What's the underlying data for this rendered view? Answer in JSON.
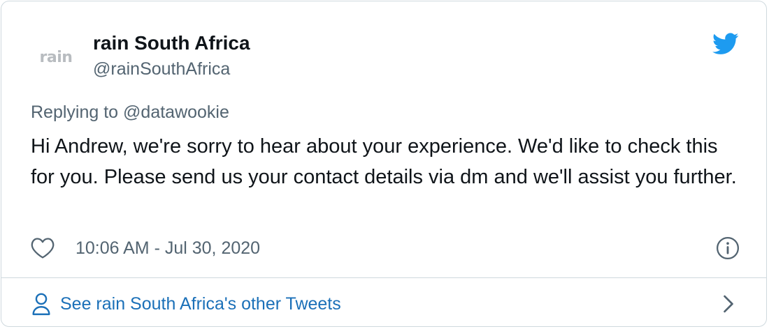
{
  "author": {
    "display_name": "rain South Africa",
    "handle": "@rainSouthAfrica",
    "avatar_text": "rain"
  },
  "reply": {
    "prefix": "Replying to ",
    "mention": "@datawookie"
  },
  "tweet": {
    "text": "Hi Andrew, we're sorry to hear about your experience. We'd like to check this for you. Please send us your contact details via dm and we'll assist you further."
  },
  "meta": {
    "timestamp": "10:06 AM - Jul 30, 2020"
  },
  "footer": {
    "link_label": "See rain South Africa's other Tweets"
  },
  "icons": {
    "bird": "twitter-bird-icon",
    "heart": "heart-icon",
    "info": "info-icon",
    "person": "person-icon",
    "chevron": "chevron-right-icon"
  },
  "colors": {
    "twitter_blue": "#1d9bf0",
    "link_blue": "#1b70b8",
    "secondary_text": "#536471",
    "border": "#cfd9de"
  }
}
